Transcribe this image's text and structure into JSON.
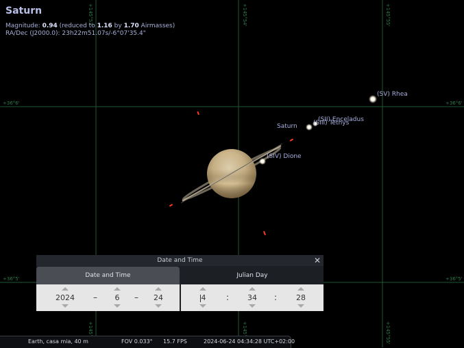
{
  "object": {
    "name": "Saturn",
    "magnitude_prefix": "Magnitude: ",
    "magnitude": "0.94",
    "reduced_prefix": " (reduced to ",
    "reduced_value": "1.16",
    "by_text": " by ",
    "airmasses": "1.70",
    "airmasses_suffix": " Airmasses)",
    "radec_label": "RA/Dec (J2000.0): ",
    "radec_value": "23h22m51.07s/-6°07'35.4\""
  },
  "sky_labels": {
    "saturn": "Saturn",
    "rhea": "(SV) Rhea",
    "enceladus": "(SII) Enceladus",
    "tethys": "(SIII) Tethys",
    "dione": "(SIV) Dione"
  },
  "grid_labels": {
    "dec_top_left": "+36°6'",
    "dec_top_right": "+36°6'",
    "dec_bottom_left": "+36°5'",
    "dec_bottom_right": "+36°5'",
    "ra_1_top": "+145°53'",
    "ra_2_top": "+145°54'",
    "ra_3_top": "+145°55'",
    "ra_1_bottom": "+145°53'",
    "ra_2_bottom": "+145°54'",
    "ra_3_bottom": "+145°55'"
  },
  "dialog": {
    "title": "Date and Time",
    "close_icon": "close-icon",
    "tab_date_time": "Date and Time",
    "tab_julian_day": "Julian Day",
    "year": "2024",
    "month": "6",
    "day": "24",
    "date_sep": "–",
    "hour": "4",
    "minute": "34",
    "second": "28",
    "time_sep": ":"
  },
  "status": {
    "location": "Earth, casa mia, 40 m",
    "fov": "FOV 0.033°",
    "fps": "15.7 FPS",
    "datetime": "2024-06-24 04:34:28 UTC+02:00"
  },
  "colors": {
    "grid": "#1f5a36",
    "label": "#a8b0e0",
    "saturn_body": "#d7c29a",
    "moon_marker": "#ff3a22"
  }
}
